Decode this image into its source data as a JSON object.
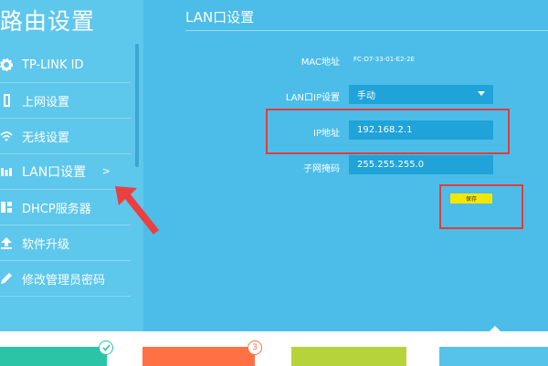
{
  "sidebar": {
    "title": "路由设置",
    "items": [
      {
        "label": "TP-LINK ID",
        "icon": "gear-icon"
      },
      {
        "label": "上网设置",
        "icon": "internet-icon"
      },
      {
        "label": "无线设置",
        "icon": "wifi-icon"
      },
      {
        "label": "LAN口设置",
        "icon": "lan-icon",
        "chevron": ">"
      },
      {
        "label": "DHCP服务器",
        "icon": "dhcp-icon"
      },
      {
        "label": "软件升级",
        "icon": "upgrade-icon"
      },
      {
        "label": "修改管理员密码",
        "icon": "pencil-icon"
      }
    ]
  },
  "main": {
    "title": "LAN口设置",
    "mac_label": "MAC地址",
    "mac_value": "FC-D7-33-01-E2-2E",
    "mode_label": "LAN口IP设置",
    "mode_value": "手动",
    "ip_label": "IP地址",
    "ip_value": "192.168.2.1",
    "mask_label": "子网掩码",
    "mask_value": "255.255.255.0",
    "save_label": "保存"
  },
  "bottom": {
    "badge_count": "3"
  },
  "colors": {
    "page_bg": "#4cbde8",
    "sidebar_bg": "#5ec7ec",
    "field_bg": "#1fa3d8",
    "highlight": "#e53b3b",
    "save_bg": "#f5e600",
    "card_teal": "#2bc4a7",
    "card_orange": "#ff7145",
    "card_lime": "#b7d33c",
    "card_blue": "#55c3ea"
  }
}
